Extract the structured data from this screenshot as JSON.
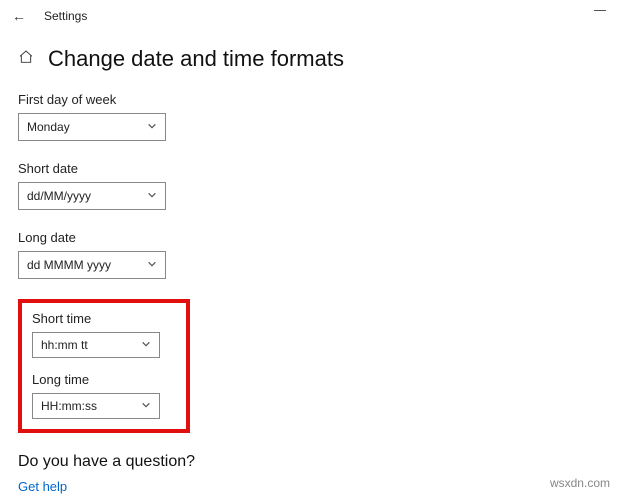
{
  "titlebar": {
    "app_title": "Settings"
  },
  "header": {
    "page_title": "Change date and time formats"
  },
  "fields": {
    "first_day_of_week": {
      "label": "First day of week",
      "value": "Monday"
    },
    "short_date": {
      "label": "Short date",
      "value": "dd/MM/yyyy"
    },
    "long_date": {
      "label": "Long date",
      "value": "dd MMMM yyyy"
    },
    "short_time": {
      "label": "Short time",
      "value": "hh:mm tt"
    },
    "long_time": {
      "label": "Long time",
      "value": "HH:mm:ss"
    }
  },
  "footer": {
    "question": "Do you have a question?",
    "help_link": "Get help"
  },
  "watermark": "wsxdn.com"
}
